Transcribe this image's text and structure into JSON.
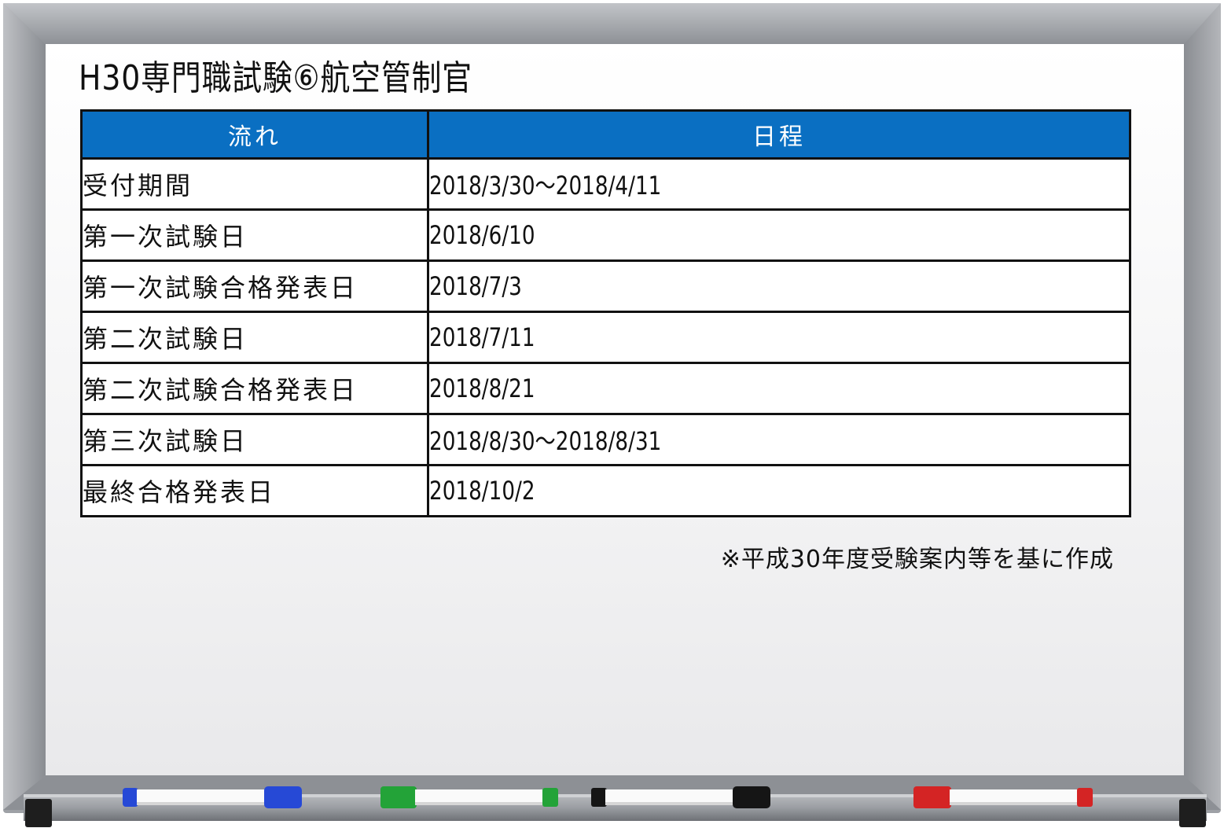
{
  "board": {
    "title": "H30専門職試験⑥航空管制官",
    "frame_color": "#9ea1a6",
    "surface_color": "#f2f2f3"
  },
  "table": {
    "header_color": "#0a6fc2",
    "headers": {
      "step": "流れ",
      "date": "日程"
    },
    "rows": [
      {
        "step": "受付期間",
        "date": "2018/3/30〜2018/4/11"
      },
      {
        "step": "第一次試験日",
        "date": "2018/6/10"
      },
      {
        "step": "第一次試験合格発表日",
        "date": "2018/7/3"
      },
      {
        "step": "第二次試験日",
        "date": "2018/7/11"
      },
      {
        "step": "第二次試験合格発表日",
        "date": "2018/8/21"
      },
      {
        "step": "第三次試験日",
        "date": "2018/8/30〜2018/8/31"
      },
      {
        "step": "最終合格発表日",
        "date": "2018/10/2"
      }
    ]
  },
  "note": "※平成30年度受験案内等を基に作成",
  "markers": [
    {
      "name": "blue",
      "cap_color": "#2649d6"
    },
    {
      "name": "green",
      "cap_color": "#23a338"
    },
    {
      "name": "black",
      "cap_color": "#151515"
    },
    {
      "name": "red",
      "cap_color": "#d42424"
    }
  ]
}
